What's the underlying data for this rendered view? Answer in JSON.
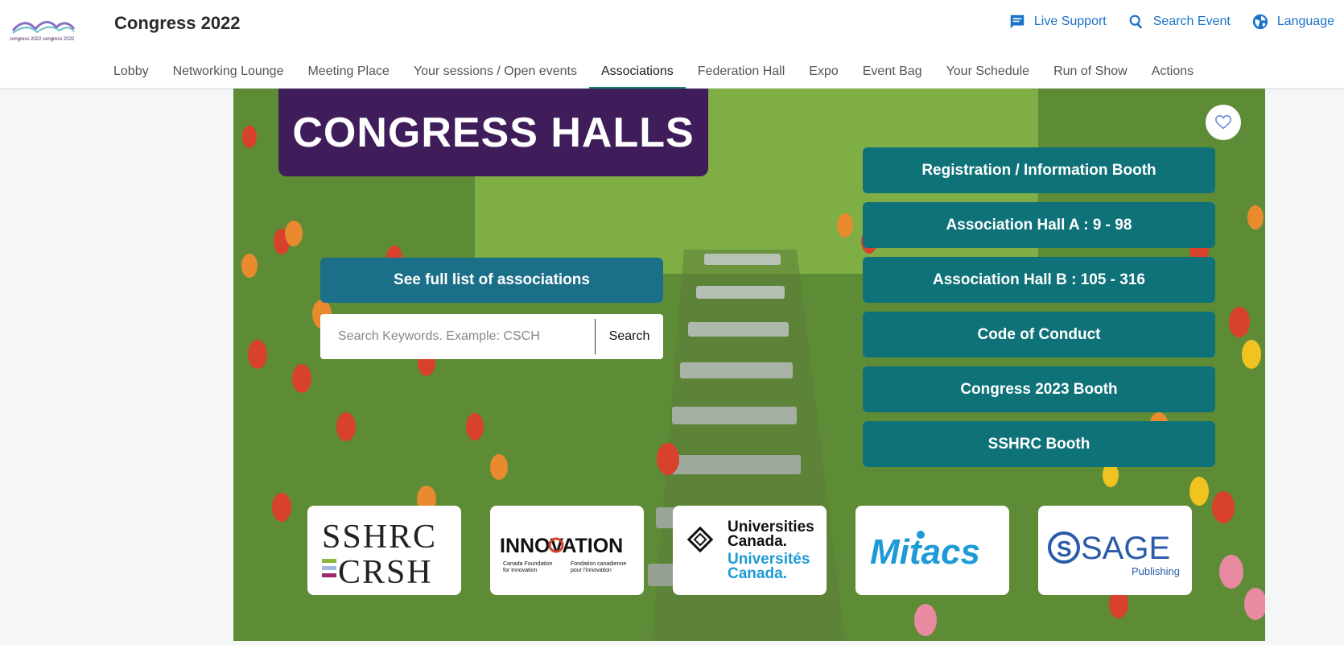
{
  "header": {
    "logo_text": "congress 2022 congress 2022",
    "title": "Congress 2022",
    "actions": [
      {
        "label": "Live Support",
        "icon": "chat-icon"
      },
      {
        "label": "Search Event",
        "icon": "search-icon"
      },
      {
        "label": "Language",
        "icon": "globe-icon"
      }
    ]
  },
  "nav": {
    "items": [
      {
        "label": "Lobby"
      },
      {
        "label": "Networking Lounge"
      },
      {
        "label": "Meeting Place"
      },
      {
        "label": "Your sessions / Open events"
      },
      {
        "label": "Associations"
      },
      {
        "label": "Federation Hall"
      },
      {
        "label": "Expo"
      },
      {
        "label": "Event Bag"
      },
      {
        "label": "Your Schedule"
      },
      {
        "label": "Run of Show"
      },
      {
        "label": "Actions"
      }
    ],
    "active": "Associations"
  },
  "hero": {
    "banner_title": "CONGRESS HALLS",
    "favorite_icon": "heart-icon",
    "full_list_label": "See full list of associations",
    "search": {
      "placeholder": "Search Keywords. Example: CSCH",
      "value": "",
      "button_label": "Search"
    },
    "booths": [
      {
        "label": "Registration / Information Booth"
      },
      {
        "label": "Association Hall A : 9 - 98"
      },
      {
        "label": "Association Hall B : 105 - 316"
      },
      {
        "label": "Code of Conduct"
      },
      {
        "label": "Congress 2023 Booth"
      },
      {
        "label": "SSHRC Booth"
      }
    ]
  },
  "sponsors": [
    {
      "name": "SSHRC CRSH",
      "lines": [
        "SSHRC",
        "CRSH"
      ]
    },
    {
      "name": "INNOVATION",
      "lines": [
        "INNOVATION",
        "Canada Foundation",
        "for Innovation",
        "Fondation canadienne",
        "pour l'innovation"
      ]
    },
    {
      "name": "Universities Canada",
      "lines": [
        "Universities",
        "Canada.",
        "Universités",
        "Canada."
      ]
    },
    {
      "name": "Mitacs",
      "lines": [
        "Mitacs"
      ]
    },
    {
      "name": "SAGE Publishing",
      "lines": [
        "SAGE",
        "Publishing"
      ]
    }
  ],
  "colors": {
    "accent_blue": "#1a73c9",
    "banner_purple": "#3e1d5a",
    "booth_teal": "#0f7279",
    "full_list_blue": "#1c6f89",
    "active_tab_underline": "#17806f"
  }
}
